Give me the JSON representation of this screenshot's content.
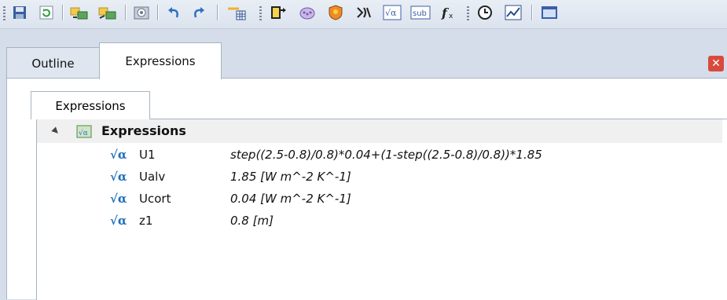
{
  "toolbar": {
    "icons": [
      "save-icon",
      "refresh-icon",
      "folder-link-icon",
      "folder-unlink-icon",
      "camera-icon",
      "undo-icon",
      "redo-icon",
      "new-table-icon",
      "geometry-icon",
      "mesh-icon",
      "shield-icon",
      "split-icon",
      "expression-icon",
      "subroutine-icon",
      "function-icon",
      "timer-icon",
      "chart-icon",
      "window-icon"
    ]
  },
  "panel": {
    "tabs": [
      {
        "label": "Outline"
      },
      {
        "label": "Expressions"
      }
    ],
    "subtab_label": "Expressions",
    "tree": {
      "root_label": "Expressions",
      "rows": [
        {
          "icon": "√α",
          "name": "U1",
          "expression": "step((2.5-0.8)/0.8)*0.04+(1-step((2.5-0.8)/0.8))*1.85"
        },
        {
          "icon": "√α",
          "name": "Ualv",
          "expression": "1.85 [W m^-2 K^-1]"
        },
        {
          "icon": "√α",
          "name": "Ucort",
          "expression": "0.04 [W m^-2 K^-1]"
        },
        {
          "icon": "√α",
          "name": "z1",
          "expression": "0.8 [m]"
        }
      ]
    }
  },
  "colors": {
    "accent": "#1a6fbf",
    "close": "#d94a3d"
  }
}
